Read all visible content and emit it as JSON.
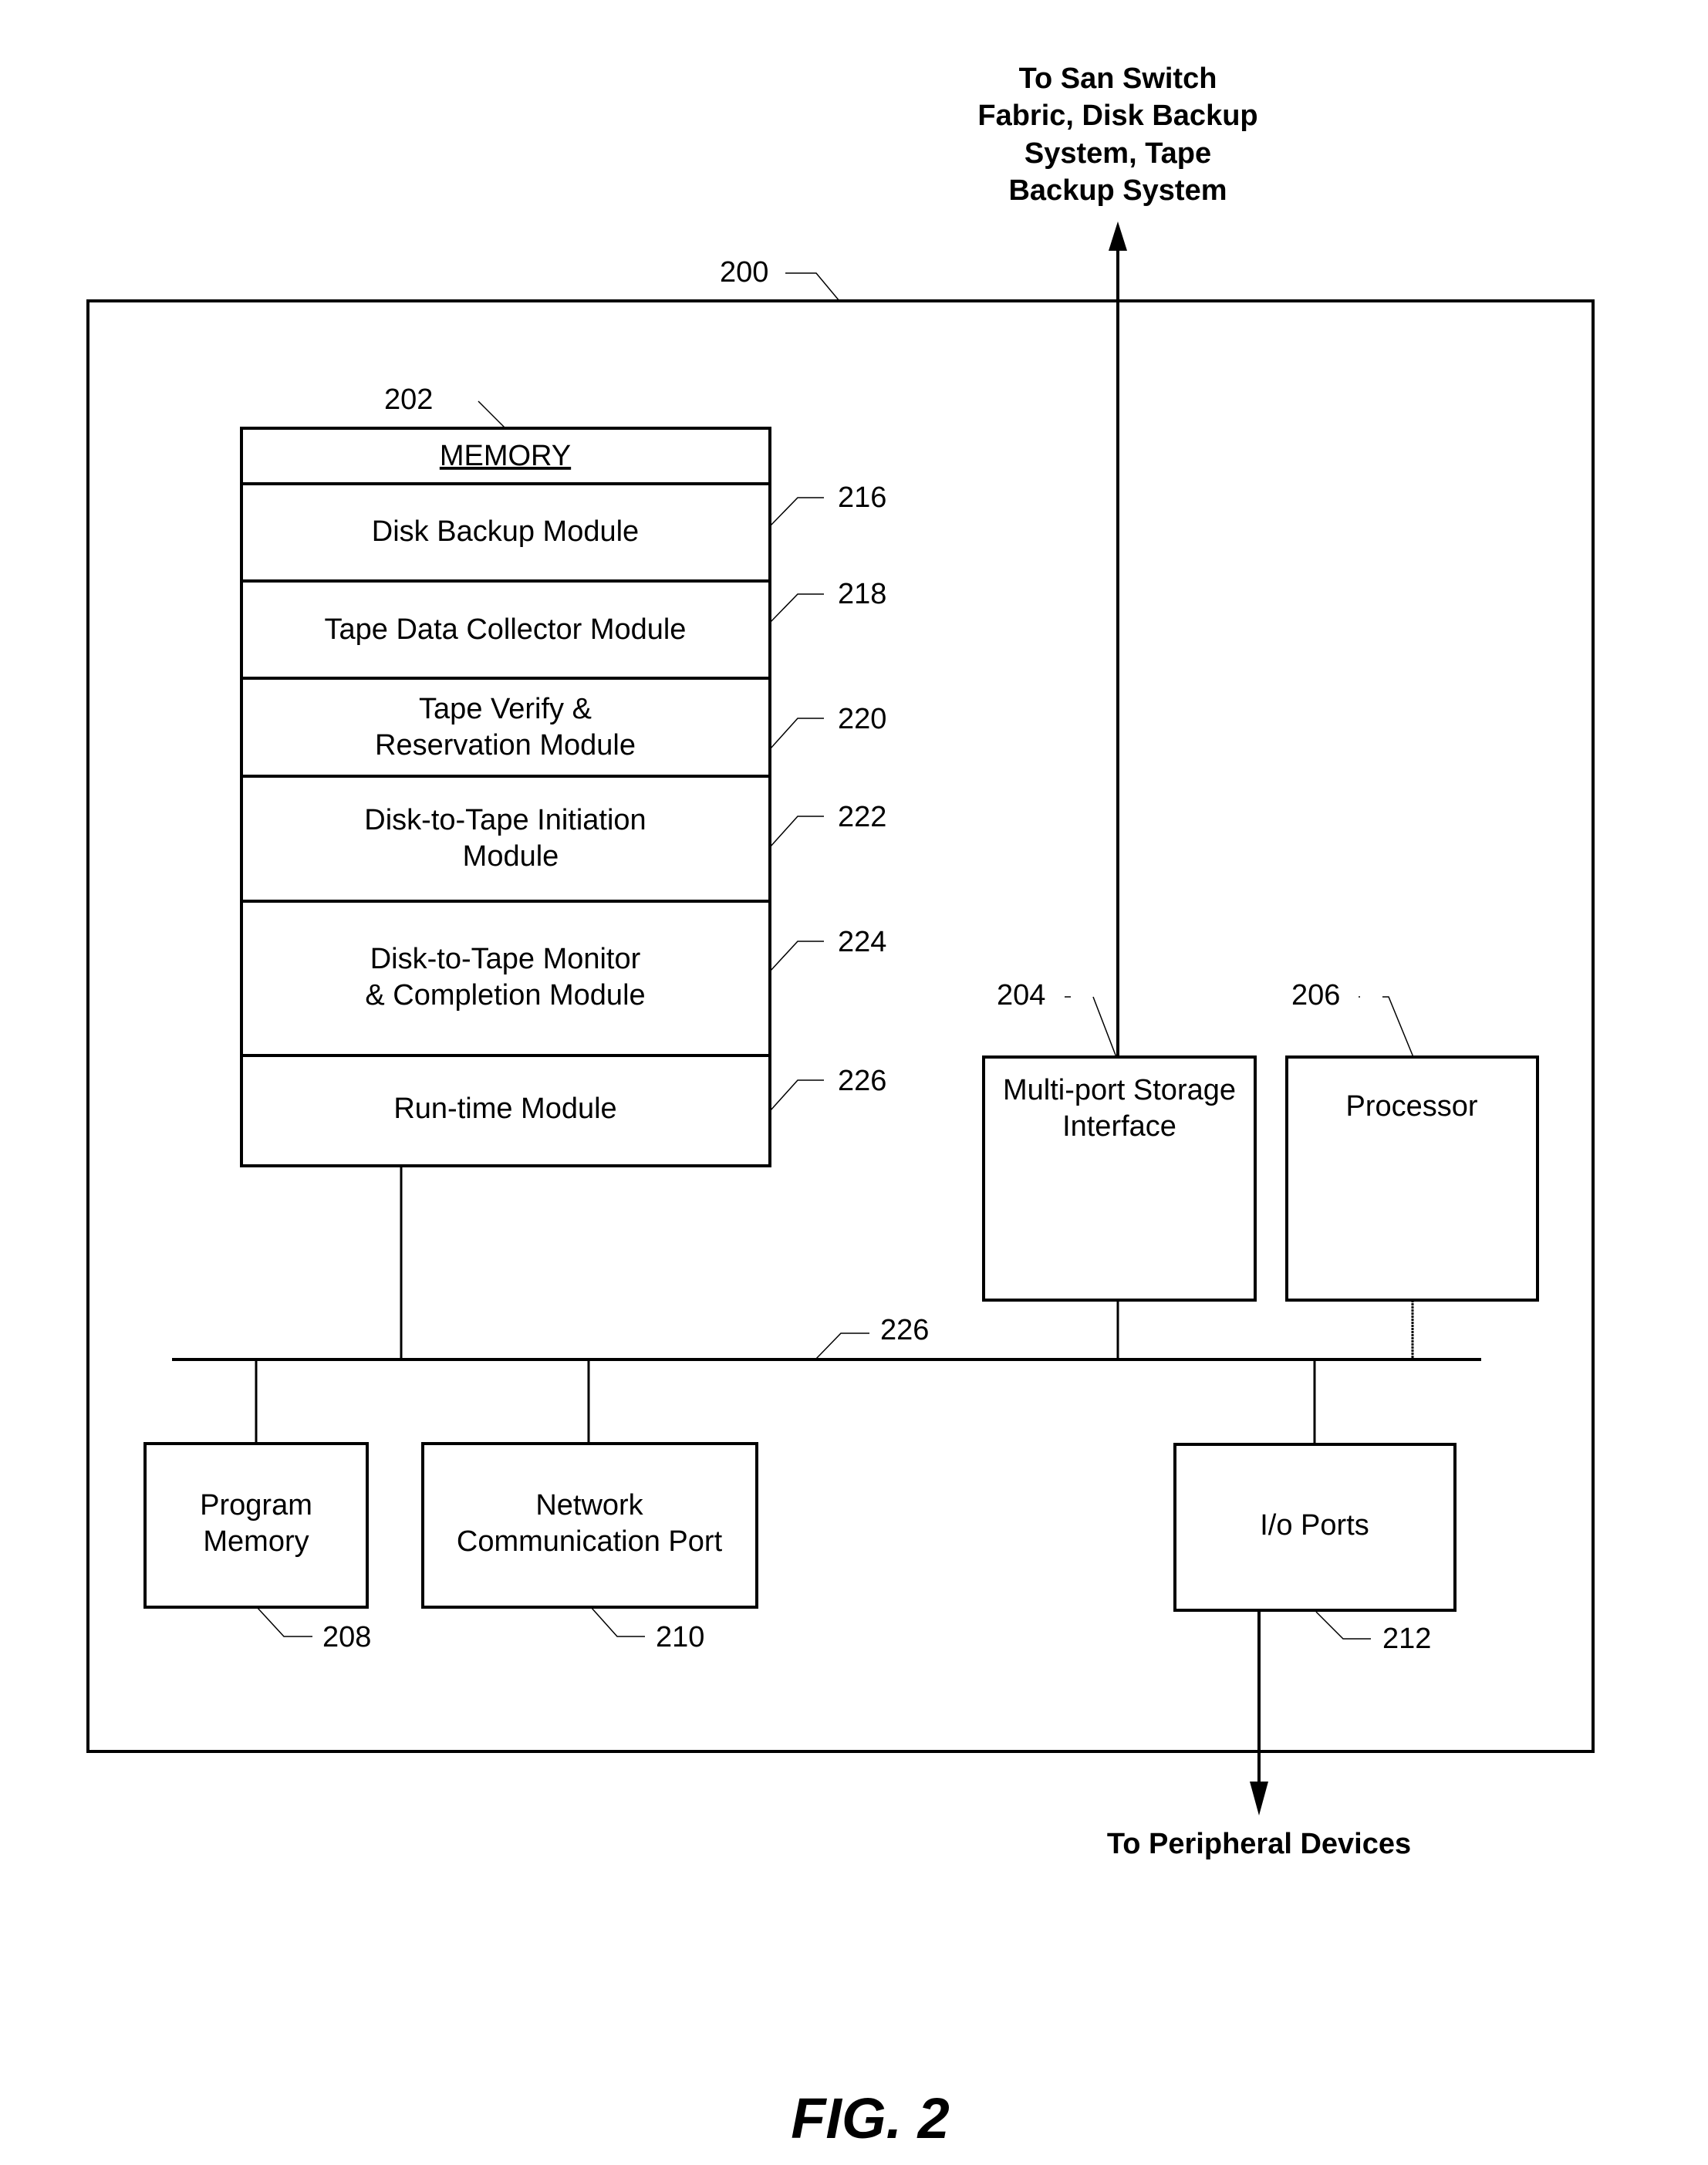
{
  "figure": {
    "caption": "FIG. 2",
    "outer_ref": "200"
  },
  "external": {
    "top_lines": [
      "To San Switch",
      "Fabric, Disk Backup",
      "System, Tape",
      "Backup System"
    ],
    "bottom": "To Peripheral Devices"
  },
  "memory": {
    "ref": "202",
    "title": "MEMORY",
    "modules": [
      {
        "ref": "216",
        "lines": [
          "Disk Backup Module"
        ]
      },
      {
        "ref": "218",
        "lines": [
          "Tape Data Collector Module"
        ]
      },
      {
        "ref": "220",
        "lines": [
          "Tape Verify &",
          "Reservation Module"
        ]
      },
      {
        "ref": "222",
        "lines": [
          "Disk-to-Tape Initiation",
          "Module"
        ]
      },
      {
        "ref": "224",
        "lines": [
          "Disk-to-Tape Monitor",
          "& Completion Module"
        ]
      },
      {
        "ref": "226",
        "lines": [
          "Run-time Module"
        ]
      }
    ]
  },
  "components": {
    "storage_interface": {
      "ref": "204",
      "lines": [
        "Multi-port Storage",
        "Interface"
      ]
    },
    "processor": {
      "ref": "206",
      "lines": [
        "Processor"
      ]
    },
    "program_memory": {
      "ref": "208",
      "lines": [
        "Program",
        "Memory"
      ]
    },
    "network_port": {
      "ref": "210",
      "lines": [
        "Network",
        "Communication Port"
      ]
    },
    "io_ports": {
      "ref": "212",
      "lines": [
        "I/o Ports"
      ]
    }
  },
  "bus": {
    "ref": "226"
  }
}
